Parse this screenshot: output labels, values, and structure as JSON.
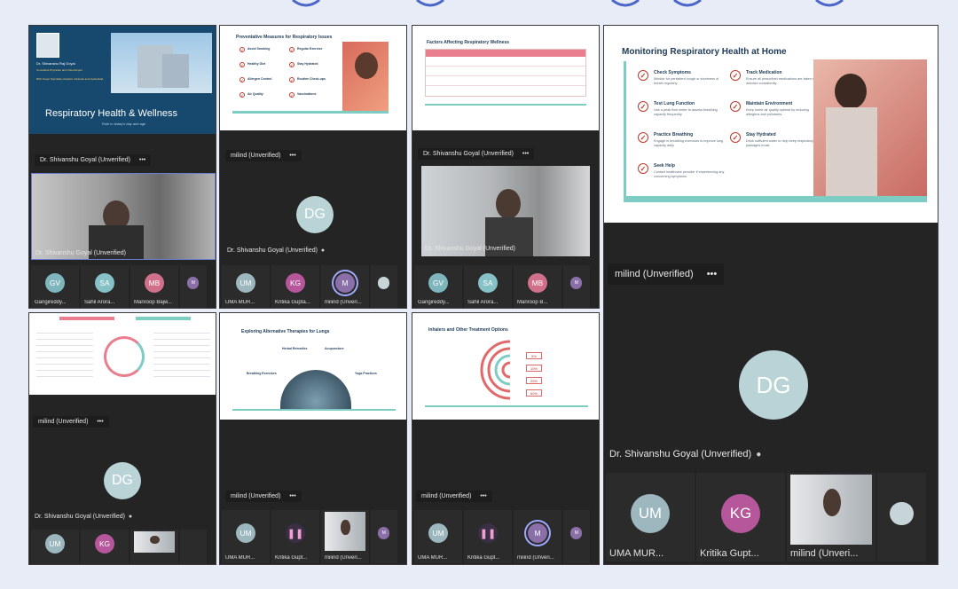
{
  "colors": {
    "panel_bg": "#242424",
    "accent_teal": "#7ecdc4",
    "accent_red": "#c0392b",
    "avatar_dg": "#b9d3d6",
    "avatar_gv": "#7fb6bd",
    "avatar_sa": "#86c1c7",
    "avatar_mb": "#d1708a",
    "avatar_m": "#8b6fa8",
    "avatar_kg": "#b5579a",
    "avatar_um": "#9cb7bd"
  },
  "panels": {
    "p1": {
      "slide": {
        "doctor_name": "Dr. Shivanshu Raj Goyal",
        "doctor_role": "Consultant Physician and Chest Expert",
        "hospital": "BHU Super Speciality Hospital, Varanasi and Hyderabad",
        "title": "Respiratory Health & Wellness",
        "subtitle": "Role in today's day and age"
      },
      "presenter_chip": "Dr. Shivanshu  Goyal (Unverified)",
      "more": "•••",
      "video_label": "Dr. Shivanshu  Goyal (Unverified)",
      "tiles": [
        {
          "initials": "GV",
          "label": "Gangireddy..."
        },
        {
          "initials": "SA",
          "label": "Sahil  Arora..."
        },
        {
          "initials": "MB",
          "label": "Manroop Bajw..."
        },
        {
          "initials": "M",
          "label": ""
        }
      ]
    },
    "p2": {
      "slide": {
        "title": "Preventative Measures for Respiratory Issues",
        "items": [
          "Avoid Smoking",
          "Healthy Diet",
          "Allergen Control",
          "Air Quality",
          "Regular Exercise",
          "Stay Hydrated",
          "Routine Check-ups",
          "Vaccinations"
        ]
      },
      "presenter_chip": "milind (Unverified)",
      "more": "•••",
      "avatar": "DG",
      "video_label": "Dr. Shivanshu  Goyal (Unverified)",
      "tiles": [
        {
          "initials": "UM",
          "label": "UMA  MUR..."
        },
        {
          "initials": "KG",
          "label": "Kritika  Gupta..."
        },
        {
          "initials": "M",
          "label": "milind (Unveri..."
        },
        {
          "initials": "",
          "label": ""
        }
      ]
    },
    "p3": {
      "slide": {
        "title": "Factors Affecting Respiratory Wellness"
      },
      "presenter_chip": "Dr. Shivanshu  Goyal (Unverified)",
      "more": "•••",
      "video_label": "Dr. Shivanshu  Goyal (Unverified)",
      "tiles": [
        {
          "initials": "GV",
          "label": "Gangireddy..."
        },
        {
          "initials": "SA",
          "label": "Sahil  Arora..."
        },
        {
          "initials": "MB",
          "label": "Manroop B..."
        },
        {
          "initials": "M",
          "label": ""
        }
      ]
    },
    "p4": {
      "slide": {
        "title": "Monitoring Respiratory Health at Home",
        "items": [
          {
            "heading": "Check Symptoms",
            "text": "Monitor for persistent cough or shortness of breath regularly."
          },
          {
            "heading": "Track Medication",
            "text": "Ensure all prescribed medications are taken as directed consistently."
          },
          {
            "heading": "Test Lung Function",
            "text": "Use a peak flow meter to assess breathing capacity frequently."
          },
          {
            "heading": "Maintain Environment",
            "text": "Keep home air quality optimal by reducing allergens and pollutants."
          },
          {
            "heading": "Practice Breathing",
            "text": "Engage in breathing exercises to improve lung capacity daily."
          },
          {
            "heading": "Stay Hydrated",
            "text": "Drink sufficient water to help keep respiratory passages moist."
          },
          {
            "heading": "Seek Help",
            "text": "Contact healthcare provider if experiencing any concerning symptoms."
          }
        ]
      },
      "presenter_chip": "milind (Unverified)",
      "more": "•••",
      "avatar": "DG",
      "video_label": "Dr. Shivanshu  Goyal (Unverified)",
      "tiles": [
        {
          "initials": "UM",
          "label": "UMA  MUR..."
        },
        {
          "initials": "KG",
          "label": "Kritika  Gupt..."
        },
        {
          "initials": "",
          "label": "milind (Unveri..."
        },
        {
          "initials": "",
          "label": ""
        }
      ]
    },
    "p5": {
      "presenter_chip": "milind (Unverified)",
      "more": "•••",
      "avatar": "DG",
      "video_label": "Dr. Shivanshu  Goyal (Unverified)",
      "tiles": [
        {
          "initials": "UM",
          "label": ""
        },
        {
          "initials": "KG",
          "label": ""
        },
        {
          "initials": "",
          "label": ""
        },
        {
          "initials": "",
          "label": ""
        }
      ]
    },
    "p6": {
      "slide": {
        "title": "Exploring Alternative Therapies for Lungs",
        "items": [
          "Herbal Remedies",
          "Acupuncture",
          "Breathing Exercises",
          "Yoga Practices"
        ]
      },
      "presenter_chip": "milind (Unverified)",
      "more": "•••",
      "tiles": [
        {
          "initials": "UM",
          "label": "UMA  MUR..."
        },
        {
          "initials": "",
          "label": "Kritika  Gupt..."
        },
        {
          "initials": "",
          "label": "milind (Unveri..."
        },
        {
          "initials": "M",
          "label": ""
        }
      ]
    },
    "p7": {
      "slide": {
        "title": "Inhalers and Other Treatment Options",
        "percents": [
          "5%",
          "10%",
          "25%",
          "60%"
        ]
      },
      "presenter_chip": "milind (Unverified)",
      "more": "•••",
      "tiles": [
        {
          "initials": "UM",
          "label": "UMA  MUR..."
        },
        {
          "initials": "",
          "label": "Kritika  Gupt..."
        },
        {
          "initials": "M",
          "label": "milind (Unveri..."
        },
        {
          "initials": "M",
          "label": ""
        }
      ]
    }
  }
}
